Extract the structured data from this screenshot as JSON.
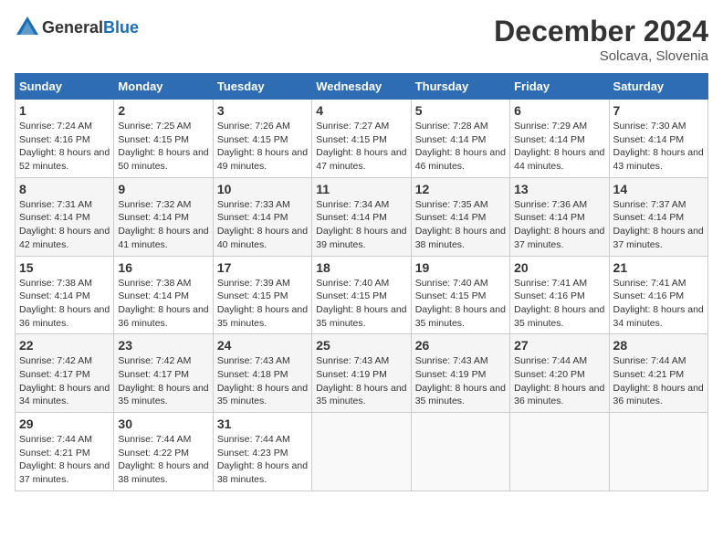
{
  "header": {
    "logo_general": "General",
    "logo_blue": "Blue",
    "title": "December 2024",
    "location": "Solcava, Slovenia"
  },
  "weekdays": [
    "Sunday",
    "Monday",
    "Tuesday",
    "Wednesday",
    "Thursday",
    "Friday",
    "Saturday"
  ],
  "weeks": [
    [
      {
        "day": "1",
        "sunrise": "Sunrise: 7:24 AM",
        "sunset": "Sunset: 4:16 PM",
        "daylight": "Daylight: 8 hours and 52 minutes."
      },
      {
        "day": "2",
        "sunrise": "Sunrise: 7:25 AM",
        "sunset": "Sunset: 4:15 PM",
        "daylight": "Daylight: 8 hours and 50 minutes."
      },
      {
        "day": "3",
        "sunrise": "Sunrise: 7:26 AM",
        "sunset": "Sunset: 4:15 PM",
        "daylight": "Daylight: 8 hours and 49 minutes."
      },
      {
        "day": "4",
        "sunrise": "Sunrise: 7:27 AM",
        "sunset": "Sunset: 4:15 PM",
        "daylight": "Daylight: 8 hours and 47 minutes."
      },
      {
        "day": "5",
        "sunrise": "Sunrise: 7:28 AM",
        "sunset": "Sunset: 4:14 PM",
        "daylight": "Daylight: 8 hours and 46 minutes."
      },
      {
        "day": "6",
        "sunrise": "Sunrise: 7:29 AM",
        "sunset": "Sunset: 4:14 PM",
        "daylight": "Daylight: 8 hours and 44 minutes."
      },
      {
        "day": "7",
        "sunrise": "Sunrise: 7:30 AM",
        "sunset": "Sunset: 4:14 PM",
        "daylight": "Daylight: 8 hours and 43 minutes."
      }
    ],
    [
      {
        "day": "8",
        "sunrise": "Sunrise: 7:31 AM",
        "sunset": "Sunset: 4:14 PM",
        "daylight": "Daylight: 8 hours and 42 minutes."
      },
      {
        "day": "9",
        "sunrise": "Sunrise: 7:32 AM",
        "sunset": "Sunset: 4:14 PM",
        "daylight": "Daylight: 8 hours and 41 minutes."
      },
      {
        "day": "10",
        "sunrise": "Sunrise: 7:33 AM",
        "sunset": "Sunset: 4:14 PM",
        "daylight": "Daylight: 8 hours and 40 minutes."
      },
      {
        "day": "11",
        "sunrise": "Sunrise: 7:34 AM",
        "sunset": "Sunset: 4:14 PM",
        "daylight": "Daylight: 8 hours and 39 minutes."
      },
      {
        "day": "12",
        "sunrise": "Sunrise: 7:35 AM",
        "sunset": "Sunset: 4:14 PM",
        "daylight": "Daylight: 8 hours and 38 minutes."
      },
      {
        "day": "13",
        "sunrise": "Sunrise: 7:36 AM",
        "sunset": "Sunset: 4:14 PM",
        "daylight": "Daylight: 8 hours and 37 minutes."
      },
      {
        "day": "14",
        "sunrise": "Sunrise: 7:37 AM",
        "sunset": "Sunset: 4:14 PM",
        "daylight": "Daylight: 8 hours and 37 minutes."
      }
    ],
    [
      {
        "day": "15",
        "sunrise": "Sunrise: 7:38 AM",
        "sunset": "Sunset: 4:14 PM",
        "daylight": "Daylight: 8 hours and 36 minutes."
      },
      {
        "day": "16",
        "sunrise": "Sunrise: 7:38 AM",
        "sunset": "Sunset: 4:14 PM",
        "daylight": "Daylight: 8 hours and 36 minutes."
      },
      {
        "day": "17",
        "sunrise": "Sunrise: 7:39 AM",
        "sunset": "Sunset: 4:15 PM",
        "daylight": "Daylight: 8 hours and 35 minutes."
      },
      {
        "day": "18",
        "sunrise": "Sunrise: 7:40 AM",
        "sunset": "Sunset: 4:15 PM",
        "daylight": "Daylight: 8 hours and 35 minutes."
      },
      {
        "day": "19",
        "sunrise": "Sunrise: 7:40 AM",
        "sunset": "Sunset: 4:15 PM",
        "daylight": "Daylight: 8 hours and 35 minutes."
      },
      {
        "day": "20",
        "sunrise": "Sunrise: 7:41 AM",
        "sunset": "Sunset: 4:16 PM",
        "daylight": "Daylight: 8 hours and 35 minutes."
      },
      {
        "day": "21",
        "sunrise": "Sunrise: 7:41 AM",
        "sunset": "Sunset: 4:16 PM",
        "daylight": "Daylight: 8 hours and 34 minutes."
      }
    ],
    [
      {
        "day": "22",
        "sunrise": "Sunrise: 7:42 AM",
        "sunset": "Sunset: 4:17 PM",
        "daylight": "Daylight: 8 hours and 34 minutes."
      },
      {
        "day": "23",
        "sunrise": "Sunrise: 7:42 AM",
        "sunset": "Sunset: 4:17 PM",
        "daylight": "Daylight: 8 hours and 35 minutes."
      },
      {
        "day": "24",
        "sunrise": "Sunrise: 7:43 AM",
        "sunset": "Sunset: 4:18 PM",
        "daylight": "Daylight: 8 hours and 35 minutes."
      },
      {
        "day": "25",
        "sunrise": "Sunrise: 7:43 AM",
        "sunset": "Sunset: 4:19 PM",
        "daylight": "Daylight: 8 hours and 35 minutes."
      },
      {
        "day": "26",
        "sunrise": "Sunrise: 7:43 AM",
        "sunset": "Sunset: 4:19 PM",
        "daylight": "Daylight: 8 hours and 35 minutes."
      },
      {
        "day": "27",
        "sunrise": "Sunrise: 7:44 AM",
        "sunset": "Sunset: 4:20 PM",
        "daylight": "Daylight: 8 hours and 36 minutes."
      },
      {
        "day": "28",
        "sunrise": "Sunrise: 7:44 AM",
        "sunset": "Sunset: 4:21 PM",
        "daylight": "Daylight: 8 hours and 36 minutes."
      }
    ],
    [
      {
        "day": "29",
        "sunrise": "Sunrise: 7:44 AM",
        "sunset": "Sunset: 4:21 PM",
        "daylight": "Daylight: 8 hours and 37 minutes."
      },
      {
        "day": "30",
        "sunrise": "Sunrise: 7:44 AM",
        "sunset": "Sunset: 4:22 PM",
        "daylight": "Daylight: 8 hours and 38 minutes."
      },
      {
        "day": "31",
        "sunrise": "Sunrise: 7:44 AM",
        "sunset": "Sunset: 4:23 PM",
        "daylight": "Daylight: 8 hours and 38 minutes."
      },
      null,
      null,
      null,
      null
    ]
  ]
}
